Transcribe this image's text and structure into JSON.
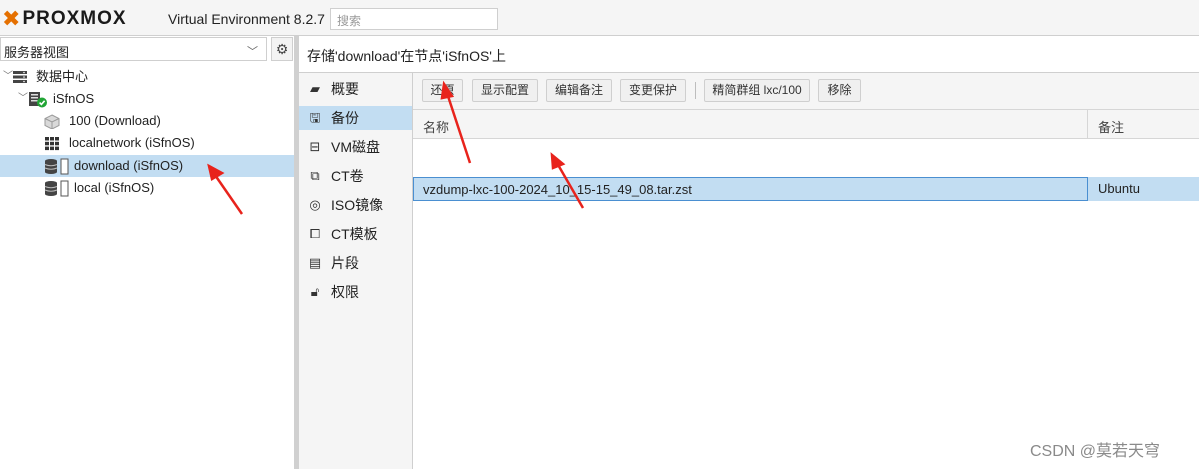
{
  "header": {
    "logo_text": "PROXMOX",
    "version": "Virtual Environment 8.2.7",
    "search_placeholder": "搜索"
  },
  "left": {
    "view_selector": "服务器视图",
    "tree": [
      {
        "label": "数据中心",
        "icon": "datacenter-icon"
      },
      {
        "label": "iSfnOS",
        "icon": "node-online-icon"
      },
      {
        "label": "100 (Download)",
        "icon": "container-icon"
      },
      {
        "label": "localnetwork (iSfnOS)",
        "icon": "sdn-grid-icon"
      },
      {
        "label": "download (iSfnOS)",
        "icon": "storage-icon",
        "selected": true
      },
      {
        "label": "local (iSfnOS)",
        "icon": "storage-icon"
      }
    ]
  },
  "right": {
    "title": "存储'download'在节点'iSfnOS'上",
    "menu": [
      {
        "label": "概要",
        "icon": "book-icon"
      },
      {
        "label": "备份",
        "icon": "floppy-icon",
        "selected": true
      },
      {
        "label": "VM磁盘",
        "icon": "hdd-icon"
      },
      {
        "label": "CT卷",
        "icon": "ct-volume-icon"
      },
      {
        "label": "ISO镜像",
        "icon": "disc-icon"
      },
      {
        "label": "CT模板",
        "icon": "template-icon"
      },
      {
        "label": "片段",
        "icon": "snippet-icon"
      },
      {
        "label": "权限",
        "icon": "unlock-icon"
      }
    ],
    "toolbar": {
      "restore": "还原",
      "show_config": "显示配置",
      "edit_notes": "编辑备注",
      "change_protection": "变更保护",
      "prune_group": "精简群组 lxc/100",
      "remove": "移除"
    },
    "grid": {
      "columns": [
        "名称",
        "备注"
      ],
      "rows": [
        {
          "name": "vzdump-lxc-100-2024_10_15-15_49_08.tar.zst",
          "notes": "Ubuntu",
          "selected": true
        }
      ]
    }
  },
  "watermark": "CSDN @莫若天穹",
  "colors": {
    "accent_orange": "#e57000",
    "selection_blue": "#c2ddf2",
    "annotation_red": "#e8231c"
  }
}
